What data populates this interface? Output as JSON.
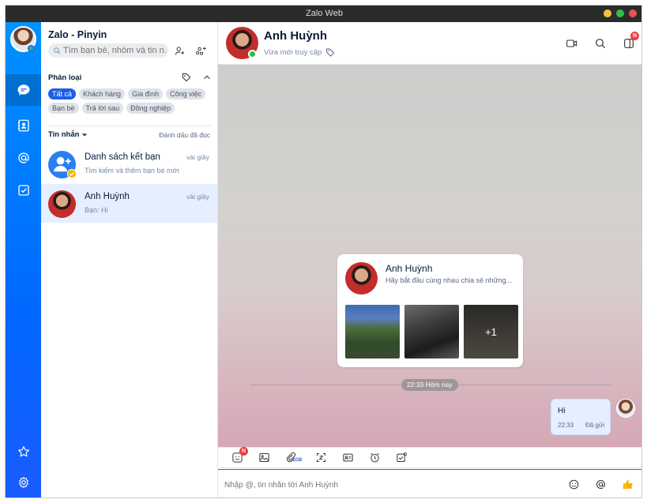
{
  "window": {
    "title": "Zalo Web"
  },
  "sidebar": {
    "items": [
      {
        "name": "messages",
        "icon": "chat-bubble-icon"
      },
      {
        "name": "contacts",
        "icon": "contact-book-icon"
      },
      {
        "name": "mentions",
        "icon": "at-sign-icon"
      },
      {
        "name": "todo",
        "icon": "checkbox-icon"
      },
      {
        "name": "favorites",
        "icon": "star-icon"
      },
      {
        "name": "settings",
        "icon": "gear-icon"
      }
    ]
  },
  "list": {
    "app_name": "Zalo - Pinyin",
    "search": {
      "placeholder": "Tìm bạn bè, nhóm và tin n..."
    },
    "category_title": "Phân loại",
    "chips": [
      "Tất cả",
      "Khách hàng",
      "Gia đình",
      "Công việc",
      "Bạn bè",
      "Trả lời sau",
      "Đồng nghiệp"
    ],
    "messages_filter": "Tin nhắn",
    "mark_read": "Đánh dấu đã đọc",
    "conversations": [
      {
        "name": "Danh sách kết bạn",
        "preview": "Tìm kiếm và thêm bạn bè mới",
        "time": "vài giây"
      },
      {
        "name": "Anh Huỳnh",
        "preview": "Bạn: Hi",
        "time": "vài giây"
      }
    ]
  },
  "chat": {
    "name": "Anh Huỳnh",
    "status": "Vừa mới truy cập",
    "notif_badge": "N",
    "card": {
      "name": "Anh Huỳnh",
      "desc": "Hãy bắt đầu cùng nhau chia sẻ những...",
      "more_count": "+1"
    },
    "time_divider": "22:33 Hôm nay",
    "message": {
      "text": "Hi",
      "time": "22:33",
      "status": "Đã gửi"
    },
    "toolbar": {
      "sticker_badge": "N",
      "file_size_label": "1GB"
    },
    "composer": {
      "placeholder": "Nhập @, tin nhắn tới Anh Huỳnh"
    }
  },
  "colors": {
    "accent": "#0068ff",
    "online": "#2dbe4f",
    "badge": "#f03d3e"
  }
}
